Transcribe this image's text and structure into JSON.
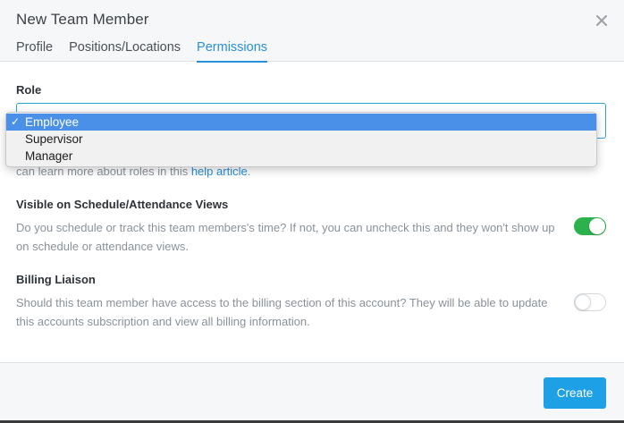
{
  "modal": {
    "title": "New Team Member",
    "tabs": [
      {
        "label": "Profile",
        "active": false
      },
      {
        "label": "Positions/Locations",
        "active": false
      },
      {
        "label": "Permissions",
        "active": true
      }
    ]
  },
  "role": {
    "label": "Role",
    "selected": "Employee",
    "options": [
      "Employee",
      "Supervisor",
      "Manager"
    ],
    "help_text": "can learn more about roles in this ",
    "help_link": "help article",
    "help_suffix": "."
  },
  "visible_on_schedule": {
    "label": "Visible on Schedule/Attendance Views",
    "description": "Do you schedule or track this team members's time? If not, you can uncheck this and they won't show up on schedule or attendance views.",
    "enabled": true
  },
  "billing_liaison": {
    "label": "Billing Liaison",
    "description": "Should this team member have access to the billing section of this account? They will be able to update this accounts subscription and view all billing information.",
    "enabled": false
  },
  "footer": {
    "create_label": "Create"
  },
  "colors": {
    "accent": "#2a8fd6",
    "toggle_on": "#2bb24c",
    "button": "#1ea0e6",
    "dropdown_highlight": "#4a90e9"
  },
  "icons": {
    "close": "close-icon",
    "check": "checkmark-icon"
  }
}
